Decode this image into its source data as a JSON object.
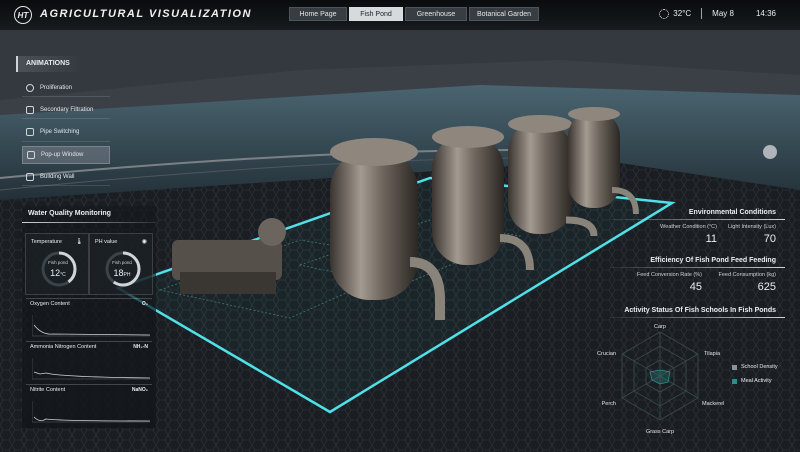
{
  "app": {
    "title": "AGRICULTURAL VISUALIZATION",
    "logo": "HT"
  },
  "tabs": [
    {
      "label": "Home Page",
      "active": false
    },
    {
      "label": "Fish Pond",
      "active": true
    },
    {
      "label": "Greenhouse",
      "active": false
    },
    {
      "label": "Botanical Garden",
      "active": false
    }
  ],
  "status": {
    "weather_icon": "sun-icon",
    "temperature": "32°C",
    "date": "May 8",
    "time": "14:36"
  },
  "animations": {
    "header": "ANIMATIONS",
    "items": [
      {
        "label": "Proliferation",
        "selected": false
      },
      {
        "label": "Secondary Filtration",
        "selected": false
      },
      {
        "label": "Pipe Switching",
        "selected": false
      },
      {
        "label": "Pop-up Window",
        "selected": true
      },
      {
        "label": "Building Wall",
        "selected": false
      }
    ]
  },
  "water_quality": {
    "title": "Water Quality Monitoring",
    "temperature": {
      "label": "Temperature",
      "sub": "Fish pond",
      "value": "12",
      "unit": "°C"
    },
    "ph": {
      "label": "PH value",
      "sub": "Fish pond",
      "value": "18",
      "unit": "PH"
    },
    "charts": [
      {
        "label": "Oxygen Content",
        "unit": "O₂"
      },
      {
        "label": "Ammonia Nitrogen Content",
        "unit": "NH₃-N"
      },
      {
        "label": "Nitrite Content",
        "unit": "NaNO₂"
      }
    ]
  },
  "environment": {
    "title": "Environmental Conditions",
    "weather_label": "Weather Condition (°C)",
    "weather_value": "11",
    "light_label": "Light Intensity (Lux)",
    "light_value": "70"
  },
  "feeding": {
    "title": "Efficiency Of Fish Pond Feed Feeding",
    "fcr_label": "Feed Conversion Rate (%)",
    "fcr_value": "45",
    "consumption_label": "Feed Consumption (kg)",
    "consumption_value": "625"
  },
  "activity": {
    "title": "Activity Status Of Fish Schools In Fish Ponds",
    "axes": [
      "Carp",
      "Tilapia",
      "Mackerel",
      "Grass Carp",
      "Perch",
      "Crucian"
    ],
    "legend": [
      {
        "name": "School Density",
        "color": "#8a9299"
      },
      {
        "name": "Meal Activity",
        "color": "#2a8f8a"
      }
    ]
  },
  "colors": {
    "accent": "#4fe0e8",
    "panel": "#12161a"
  }
}
